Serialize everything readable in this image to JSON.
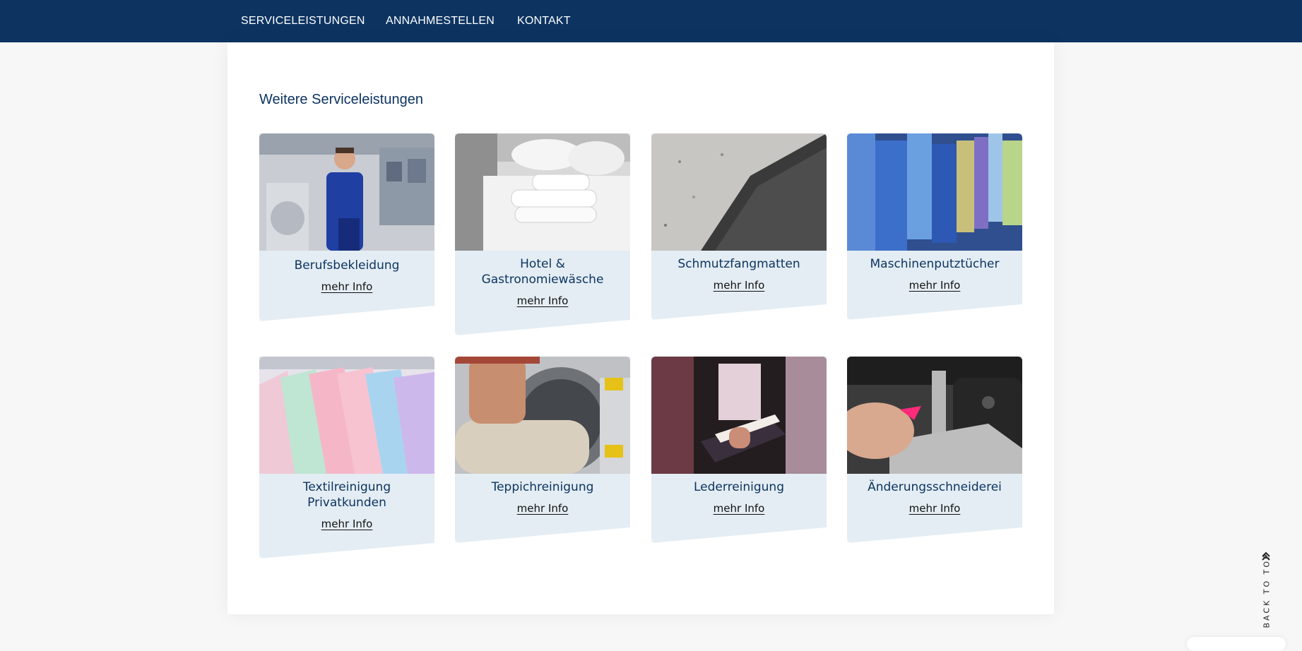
{
  "nav": {
    "items": [
      {
        "label": "SERVICELEISTUNGEN"
      },
      {
        "label": "ANNAHMESTELLEN"
      },
      {
        "label": "KONTAKT"
      }
    ]
  },
  "section": {
    "title": "Weitere Serviceleistungen"
  },
  "cards": [
    {
      "title": "Berufsbekleidung",
      "link": "mehr Info"
    },
    {
      "title": "Hotel & Gastronomiewäsche",
      "link": "mehr Info"
    },
    {
      "title": "Schmutzfangmatten",
      "link": "mehr Info"
    },
    {
      "title": "Maschinenputztücher",
      "link": "mehr Info"
    },
    {
      "title": "Textilreinigung Privatkunden",
      "link": "mehr Info"
    },
    {
      "title": "Teppichreinigung",
      "link": "mehr Info"
    },
    {
      "title": "Lederreinigung",
      "link": "mehr Info"
    },
    {
      "title": "Änderungsschneiderei",
      "link": "mehr Info"
    }
  ],
  "back_to_top": {
    "label": "BACK TO TOP",
    "icon": "double-chevron-up-icon"
  },
  "colors": {
    "nav_bg": "#0d3461",
    "title_color": "#0d3461",
    "card_bg": "#e4edf3"
  }
}
